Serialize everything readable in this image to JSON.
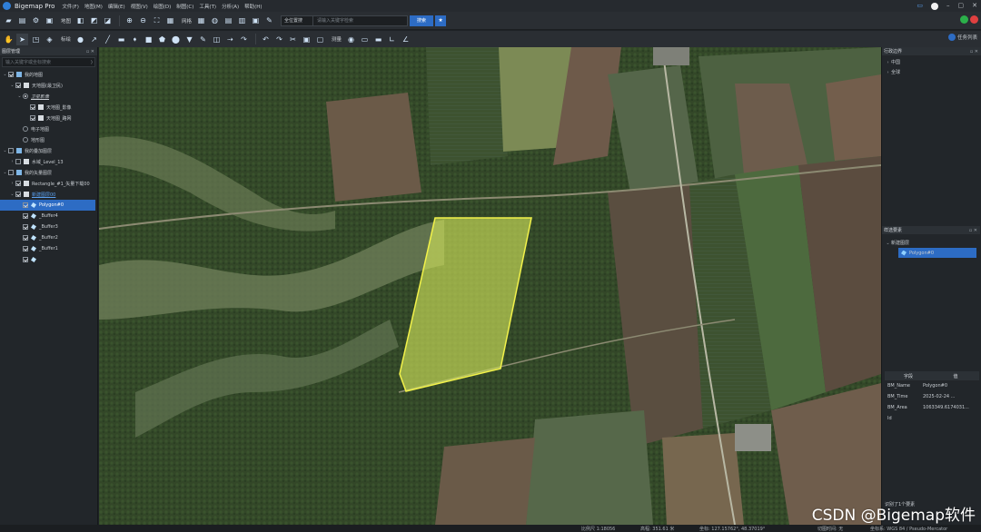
{
  "app": {
    "title": "Bigemap Pro"
  },
  "menu": [
    "文件(F)",
    "地图(M)",
    "编辑(E)",
    "视图(V)",
    "绘图(D)",
    "制图(C)",
    "工具(T)",
    "分析(A)",
    "帮助(H)"
  ],
  "toolbar1": {
    "basemap_label": "地图",
    "grid_label": "网格",
    "search_combo": "全位置搜",
    "search_placeholder": "请输入关键字检索",
    "search_button": "搜索"
  },
  "toolbar2": {
    "mark_label": "标绘",
    "measure_label": "测量",
    "task_list": "任务列表"
  },
  "left_panel": {
    "title": "图层管理",
    "search_placeholder": "输入关键字或坐标搜索",
    "tree": [
      {
        "label": "我的地图",
        "level": 0,
        "kind": "folder"
      },
      {
        "label": "天地图(最卫民)",
        "level": 1,
        "kind": "group"
      },
      {
        "label": "卫星影像",
        "level": 2,
        "kind": "radio"
      },
      {
        "label": "天地图_影像",
        "level": 3,
        "kind": "layer"
      },
      {
        "label": "天地图_路网",
        "level": 3,
        "kind": "layer"
      },
      {
        "label": "电子地图",
        "level": 2,
        "kind": "radio"
      },
      {
        "label": "地形图",
        "level": 2,
        "kind": "radio"
      },
      {
        "label": "我的叠加图层",
        "level": 0,
        "kind": "folder"
      },
      {
        "label": "水域_Level_13",
        "level": 1,
        "kind": "layer"
      },
      {
        "label": "我的矢量图层",
        "level": 0,
        "kind": "folder"
      },
      {
        "label": "Rectangle_#1_矢量下载00",
        "level": 1,
        "kind": "layer"
      },
      {
        "label": "新建图层00",
        "level": 1,
        "kind": "layer"
      },
      {
        "label": "Polygon#0",
        "level": 2,
        "kind": "feature"
      },
      {
        "label": "_Buffer4",
        "level": 2,
        "kind": "feature"
      },
      {
        "label": "_Buffer3",
        "level": 2,
        "kind": "feature"
      },
      {
        "label": "_Buffer2",
        "level": 2,
        "kind": "feature"
      },
      {
        "label": "_Buffer1",
        "level": 2,
        "kind": "feature"
      },
      {
        "label": "",
        "level": 2,
        "kind": "feature"
      }
    ]
  },
  "right_panel": {
    "top_title": "行政边界",
    "regions": [
      "中国",
      "全球"
    ],
    "select_title": "样选要素",
    "new_layer": "新建图层",
    "selected_feature": "Polygon#0",
    "fields_header": [
      "字段",
      "值"
    ],
    "fields": [
      {
        "name": "BM_Name",
        "value": "Polygon#0"
      },
      {
        "name": "BM_Time",
        "value": "2025-02-24 ..."
      },
      {
        "name": "BM_Area",
        "value": "1063349.6174031..."
      },
      {
        "name": "Id",
        "value": ""
      }
    ],
    "footer": "识别了1个要素"
  },
  "status": {
    "scale": "比例尺 1:18056",
    "elevation": "高程: 351.61 米",
    "coords": "坐标: 127.15762°, 48.37019°",
    "tile_time": "切图时间: 无",
    "projection": "坐标系: WGS 84 / Pseudo-Mercator"
  },
  "watermark": "CSDN @Bigemap软件",
  "colors": {
    "accent": "#2d6cc4",
    "polygon_fill": "#d4e65a",
    "polygon_stroke": "#f2f24a"
  }
}
